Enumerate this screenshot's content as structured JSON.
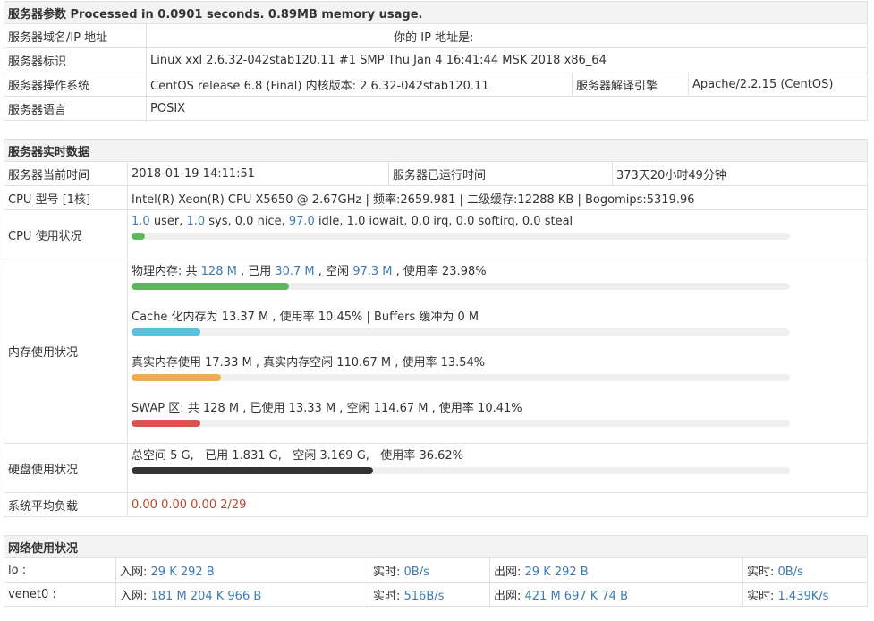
{
  "server_params": {
    "title_prefix": "服务器参数 Processed in 0.0901 seconds. 0.89MB memory usage.",
    "domain_ip_label": "服务器域名/IP 地址",
    "domain_ip_value": "",
    "your_ip_label": "你的 IP 地址是:",
    "your_ip_value": "",
    "id_label": "服务器标识",
    "id_value": "Linux xxl 2.6.32-042stab120.11 #1 SMP Thu Jan 4 16:41:44 MSK 2018 x86_64",
    "os_label": "服务器操作系统",
    "os_value": "CentOS release 6.8 (Final)  内核版本: 2.6.32-042stab120.11",
    "engine_label": "服务器解译引擎",
    "engine_value": "Apache/2.2.15 (CentOS)",
    "lang_label": "服务器语言",
    "lang_value": "POSIX"
  },
  "realtime": {
    "title": "服务器实时数据",
    "time_label": "服务器当前时间",
    "time_value": "2018-01-19 14:11:51",
    "uptime_label": "服务器已运行时间",
    "uptime_value": "373天20小时49分钟",
    "cpu_model_label": "CPU 型号 [1核]",
    "cpu_model_value": "Intel(R) Xeon(R) CPU X5650 @ 2.67GHz | 频率:2659.981 | 二级缓存:12288 KB | Bogomips:5319.96",
    "cpu_usage_label": "CPU 使用状况",
    "cpu": {
      "user": "1.0",
      "user_t": " user, ",
      "sys": "1.0",
      "sys_t": " sys, 0.0 nice, ",
      "idle": "97.0",
      "idle_t": " idle, 1.0 iowait, 0.0 irq, 0.0 softirq, 0.0 steal",
      "bar_pct": 2
    },
    "mem_label": "内存使用状况",
    "mem": {
      "phys_a": "物理内存: 共 ",
      "phys_total": "128 M",
      "phys_b": " , 已用 ",
      "phys_used": "30.7 M",
      "phys_c": " , 空闲 ",
      "phys_free": "97.3 M",
      "phys_d": " , 使用率 23.98%",
      "phys_pct": 23.98,
      "cache_text": "Cache 化内存为 13.37 M , 使用率 10.45% | Buffers 缓冲为 0 M",
      "cache_pct": 10.45,
      "real_text": "真实内存使用 17.33 M , 真实内存空闲 110.67 M , 使用率 13.54%",
      "real_pct": 13.54,
      "swap_text": "SWAP 区: 共 128 M , 已使用 13.33 M , 空闲 114.67 M , 使用率 10.41%",
      "swap_pct": 10.41
    },
    "disk_label": "硬盘使用状况",
    "disk_text": "总空间 5 G,   已用 1.831 G,   空闲 3.169 G,   使用率 36.62%",
    "disk_pct": 36.62,
    "load_label": "系统平均负载",
    "load_value": "0.00 0.00 0.00 2/29"
  },
  "network": {
    "title": "网络使用状况",
    "rows": [
      {
        "iface": "lo :",
        "in_label": "入网: ",
        "in": "29 K 292 B",
        "rt_label": "实时: ",
        "in_rt": "0B/s",
        "out_label": "出网: ",
        "out": "29 K 292 B",
        "rt2_label": "实时: ",
        "out_rt": "0B/s"
      },
      {
        "iface": "venet0 :",
        "in_label": "入网: ",
        "in": "181 M 204 K 966 B",
        "rt_label": "实时: ",
        "in_rt": "516B/s",
        "out_label": "出网: ",
        "out": "421 M 697 K 74 B",
        "rt2_label": "实时: ",
        "out_rt": "1.439K/s"
      }
    ]
  },
  "colors": {
    "accent_blue": "#3e7bb5",
    "load_red": "#b5492a",
    "bar_green": "#5cb85c",
    "bar_cyan": "#5bc0de",
    "bar_orange": "#f0ad4e",
    "bar_red": "#d9534f",
    "bar_dark": "#333333"
  }
}
